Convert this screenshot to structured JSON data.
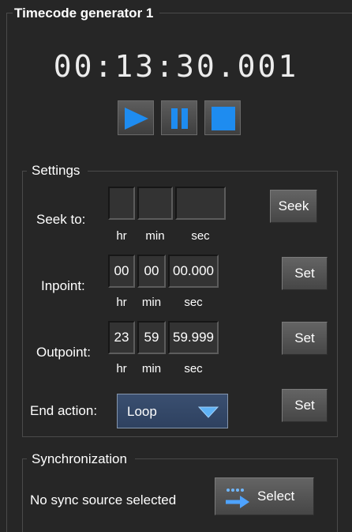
{
  "panel": {
    "title": "Timecode generator 1",
    "timecode": "00:13:30.001",
    "transport": {
      "play_icon": "play-icon",
      "pause_icon": "pause-icon",
      "stop_icon": "stop-icon"
    }
  },
  "settings": {
    "title": "Settings",
    "units": {
      "hr": "hr",
      "min": "min",
      "sec": "sec"
    },
    "seek": {
      "label": "Seek to:",
      "hr": "",
      "min": "",
      "sec": "",
      "button": "Seek"
    },
    "inpoint": {
      "label": "Inpoint:",
      "hr": "00",
      "min": "00",
      "sec": "00.000",
      "button": "Set"
    },
    "outpoint": {
      "label": "Outpoint:",
      "hr": "23",
      "min": "59",
      "sec": "59.999",
      "button": "Set"
    },
    "end_action": {
      "label": "End action:",
      "value": "Loop",
      "button": "Set"
    }
  },
  "sync": {
    "title": "Synchronization",
    "status": "No sync source selected",
    "button": "Select",
    "button_icon": "sync-source-icon"
  },
  "colors": {
    "background": "#262626",
    "accent_blue": "#1e8cf0",
    "dropdown_bg": "#34486a"
  }
}
